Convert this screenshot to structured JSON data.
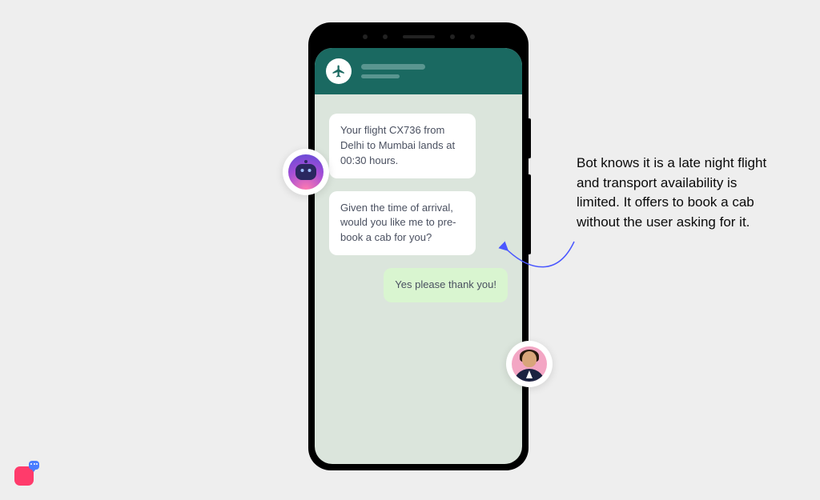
{
  "chat": {
    "header_icon": "airplane-icon",
    "messages": [
      {
        "role": "bot",
        "text": "Your flight CX736 from Delhi to Mumbai lands at 00:30 hours."
      },
      {
        "role": "bot",
        "text": "Given the time of arrival, would you like me to pre-book a cab for you?"
      },
      {
        "role": "user",
        "text": "Yes please thank you!"
      }
    ]
  },
  "annotation": {
    "text": "Bot knows it is a late night flight and transport availability is limited. It offers to book a cab without the user asking for it."
  },
  "colors": {
    "header": "#1a6961",
    "chat_bg": "#dbe5dc",
    "bot_bubble": "#ffffff",
    "user_bubble": "#d9f5d0",
    "arrow": "#4a57ff"
  }
}
